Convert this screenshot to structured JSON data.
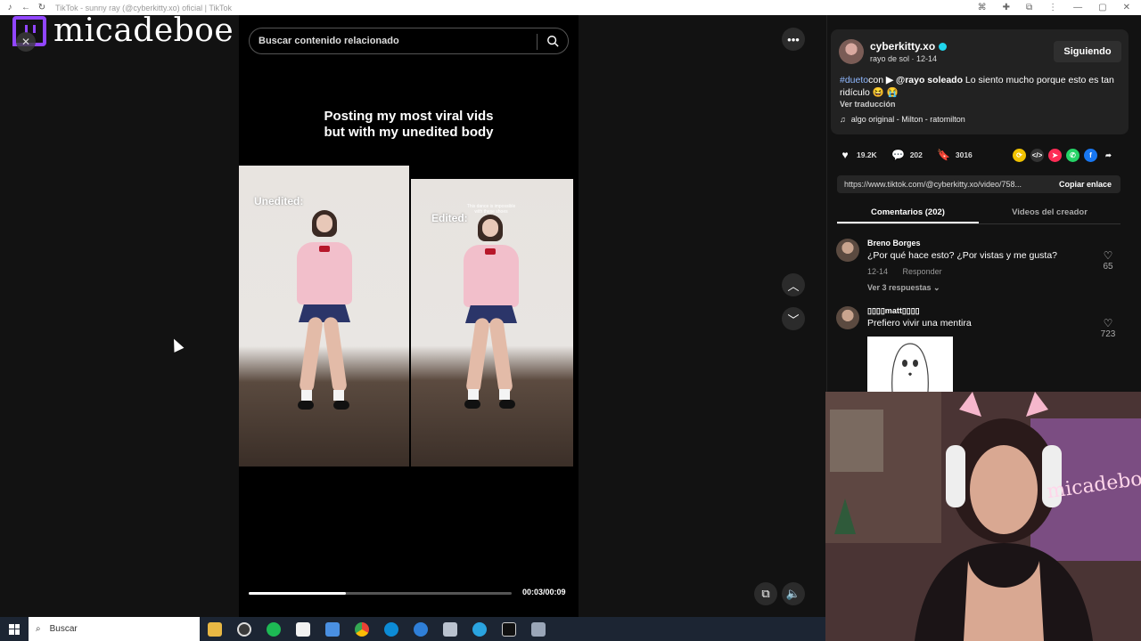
{
  "window": {
    "title": "TikTok - sunny ray (@cyberkitty.xo) oficial | TikTok"
  },
  "streamer": {
    "name": "micadeboe",
    "webcam_overlay_text": "micadeboe"
  },
  "search": {
    "placeholder": "Buscar contenido relacionado"
  },
  "video": {
    "caption": "Posting my most viral vids\nbut with my unedited body",
    "left_label": "Unedited:",
    "right_label": "Edited:",
    "right_small_text": "This dance is impossible with these shoes",
    "time": "00:03/00:09",
    "progress": 0.37
  },
  "creator": {
    "handle": "cyberkitty.xo",
    "subtitle": "rayo de sol · 12-14",
    "follow_label": "Siguiendo",
    "desc_hashtag": "#dueto",
    "desc_con": "con",
    "desc_mention": "▶ @rayo soleado",
    "desc_text": "Lo siento mucho porque esto es tan ridículo 😆 😭",
    "translate": "Ver traducción",
    "music": "algo original - Milton - ratomilton"
  },
  "stats": {
    "likes": "19.2K",
    "comments": "202",
    "saves": "3016"
  },
  "share": {
    "link": "https://www.tiktok.com/@cyberkitty.xo/video/758...",
    "copy_label": "Copiar enlace"
  },
  "tabs": {
    "comments": "Comentarios (202)",
    "creator_videos": "Videos del creador"
  },
  "comments": [
    {
      "user": "Breno Borges",
      "text": "¿Por qué hace esto? ¿Por vistas y me gusta?",
      "date": "12-14",
      "reply": "Responder",
      "replies": "Ver 3 respuestas ⌄",
      "likes": "65"
    },
    {
      "user": "▯▯▯▯matt▯▯▯▯",
      "text": "Prefiero vivir una mentira",
      "likes": "723"
    }
  ],
  "taskbar": {
    "search_label": "Buscar"
  },
  "colors": {
    "tiktok_blue": "#8fb8ff",
    "twitch_purple": "#9146ff",
    "verified": "#20d5ec"
  }
}
